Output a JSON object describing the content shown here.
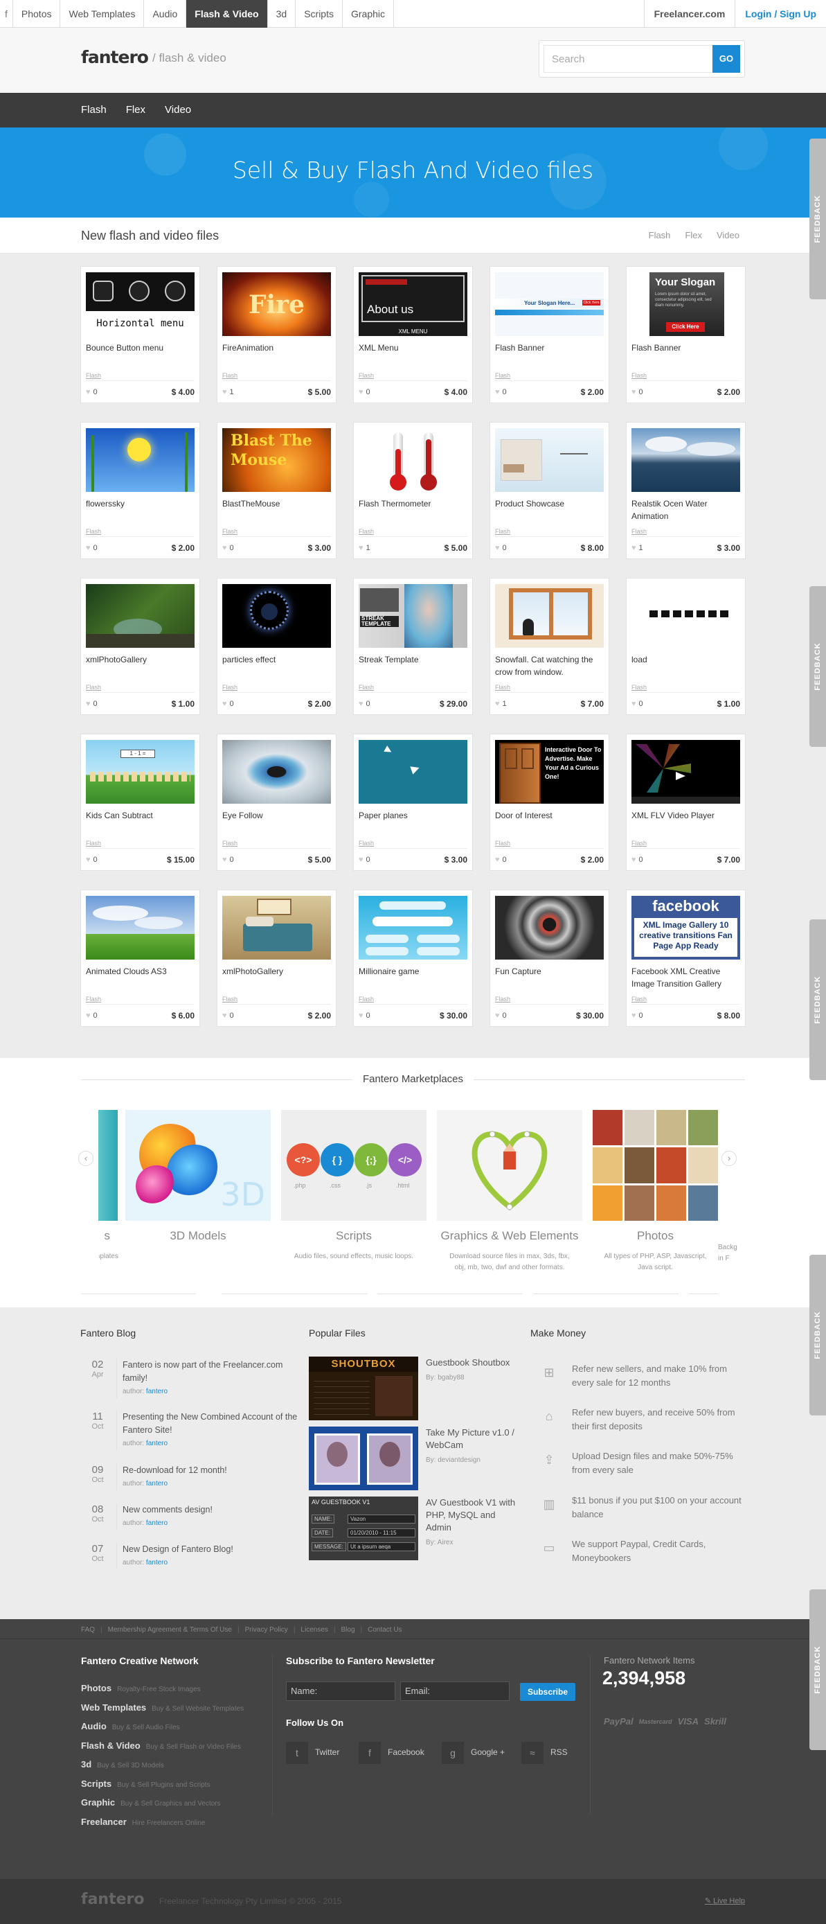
{
  "topbar": {
    "home": "f",
    "categories": [
      "Photos",
      "Web Templates",
      "Audio",
      "Flash & Video",
      "3d",
      "Scripts",
      "Graphic"
    ],
    "freelancer": "Freelancer.com",
    "login": "Login / Sign Up"
  },
  "header": {
    "logo": "fantero",
    "section": "/ flash & video",
    "search_placeholder": "Search",
    "search_button": "GO"
  },
  "subnav": [
    "Flash",
    "Flex",
    "Video"
  ],
  "banner": {
    "title": "Sell & Buy Flash And Video files"
  },
  "files": {
    "title": "New flash and video files",
    "filters": [
      "Flash",
      "Flex",
      "Video"
    ],
    "items": [
      {
        "name": "Bounce Button menu",
        "category": "Flash",
        "likes": "0",
        "price": "$ 4.00"
      },
      {
        "name": "FireAnimation",
        "category": "Flash",
        "likes": "1",
        "price": "$ 5.00"
      },
      {
        "name": "XML Menu",
        "category": "Flash",
        "likes": "0",
        "price": "$ 4.00"
      },
      {
        "name": "Flash Banner",
        "category": "Flash",
        "likes": "0",
        "price": "$ 2.00"
      },
      {
        "name": "Flash Banner",
        "category": "Flash",
        "likes": "0",
        "price": "$ 2.00"
      },
      {
        "name": "flowerssky",
        "category": "Flash",
        "likes": "0",
        "price": "$ 2.00"
      },
      {
        "name": "BlastTheMouse",
        "category": "Flash",
        "likes": "0",
        "price": "$ 3.00"
      },
      {
        "name": "Flash Thermometer",
        "category": "Flash",
        "likes": "1",
        "price": "$ 5.00"
      },
      {
        "name": "Product Showcase",
        "category": "Flash",
        "likes": "0",
        "price": "$ 8.00"
      },
      {
        "name": "Realstik Ocen Water Animation",
        "category": "Flash",
        "likes": "1",
        "price": "$ 3.00"
      },
      {
        "name": "xmlPhotoGallery",
        "category": "Flash",
        "likes": "0",
        "price": "$ 1.00"
      },
      {
        "name": "particles effect",
        "category": "Flash",
        "likes": "0",
        "price": "$ 2.00"
      },
      {
        "name": "Streak Template",
        "category": "Flash",
        "likes": "0",
        "price": "$ 29.00"
      },
      {
        "name": "Snowfall. Cat watching the crow from window.",
        "category": "Flash",
        "likes": "1",
        "price": "$ 7.00"
      },
      {
        "name": "load",
        "category": "Flash",
        "likes": "0",
        "price": "$ 1.00"
      },
      {
        "name": "Kids Can Subtract",
        "category": "Flash",
        "likes": "0",
        "price": "$ 15.00"
      },
      {
        "name": "Eye Follow",
        "category": "Flash",
        "likes": "0",
        "price": "$ 5.00"
      },
      {
        "name": "Paper planes",
        "category": "Flash",
        "likes": "0",
        "price": "$ 3.00"
      },
      {
        "name": "Door of Interest",
        "category": "Flash",
        "likes": "0",
        "price": "$ 2.00"
      },
      {
        "name": "XML FLV Video Player",
        "category": "Flash",
        "likes": "0",
        "price": "$ 7.00"
      },
      {
        "name": "Animated Clouds AS3",
        "category": "Flash",
        "likes": "0",
        "price": "$ 6.00"
      },
      {
        "name": "xmlPhotoGallery",
        "category": "Flash",
        "likes": "0",
        "price": "$ 2.00"
      },
      {
        "name": "Millionaire game",
        "category": "Flash",
        "likes": "0",
        "price": "$ 30.00"
      },
      {
        "name": "Fun Capture",
        "category": "Flash",
        "likes": "0",
        "price": "$ 30.00"
      },
      {
        "name": "Facebook XML Creative Image Transition Gallery",
        "category": "Flash",
        "likes": "0",
        "price": "$ 8.00"
      }
    ],
    "thumb_text": {
      "horizontal_menu": "Horizontal menu",
      "fire": "Fire",
      "about_us": "About us",
      "xml_menu": "XML MENU",
      "your_slogan_here": "Your Slogan Here...",
      "your_slogan": "Your Slogan",
      "slogan_body": "Lorem ipsum dolor sit amet, consectetur adipiscing elit, sed diam nonummy.",
      "click_here": "Click Here",
      "blast": "Blast The Mouse",
      "streak": "STREAK TEMPLATE",
      "interactive_door": "Interactive Door To Advertise. Make Your Ad a Curious One!",
      "facebook": "facebook",
      "fb_sub": "XML Image Gallery 10 creative transitions Fan Page App Ready"
    }
  },
  "marketplaces": {
    "title": "Fantero Marketplaces",
    "items": [
      {
        "name": "s",
        "desc": "best way to sell & buy Design Templates"
      },
      {
        "name": "3D Models",
        "desc": ""
      },
      {
        "name": "Scripts",
        "desc": "Audio files, sound effects, music loops."
      },
      {
        "name": "Graphics & Web Elements",
        "desc": "Download source files in max, 3ds, fbx, obj, mb, two, dwf and other formats."
      },
      {
        "name": "Photos",
        "desc": "All types of PHP, ASP, Javascript, Java script."
      },
      {
        "name": "",
        "desc": "Backgr in F"
      }
    ],
    "script_icons": [
      "<?>",
      "{ }",
      "{;}",
      "</>"
    ],
    "script_labels": [
      ".php",
      ".css",
      ".js",
      ".html"
    ],
    "prev": "‹",
    "next": "›"
  },
  "blog": {
    "title": "Fantero Blog",
    "author_label": "author:",
    "items": [
      {
        "day": "02",
        "month": "Apr",
        "text": "Fantero is now part of the Freelancer.com family!",
        "author": "fantero"
      },
      {
        "day": "11",
        "month": "Oct",
        "text": "Presenting the New Combined Account of the Fantero Site!",
        "author": "fantero"
      },
      {
        "day": "09",
        "month": "Oct",
        "text": "Re-download for 12 month!",
        "author": "fantero"
      },
      {
        "day": "08",
        "month": "Oct",
        "text": "New comments design!",
        "author": "fantero"
      },
      {
        "day": "07",
        "month": "Oct",
        "text": "New Design of Fantero Blog!",
        "author": "fantero"
      }
    ]
  },
  "popular": {
    "title": "Popular Files",
    "items": [
      {
        "name": "Guestbook Shoutbox",
        "by": "By: bgaby88"
      },
      {
        "name": "Take My Picture v1.0 / WebCam",
        "by": "By: deviantdesign"
      },
      {
        "name": "AV Guestbook V1 with PHP, MySQL and Admin",
        "by": "By: Airex"
      }
    ],
    "thumb_text": {
      "shoutbox": "SHOUTBOX",
      "avgb": "AV GUESTBOOK V1",
      "name": "NAME:",
      "name_val": "Vazon",
      "date": "DATE:",
      "date_val": "01/20/2010 - 11:15",
      "message": "MESSAGE:",
      "message_val": "Ut a ipsum aeqa"
    }
  },
  "make_money": {
    "title": "Make Money",
    "items": [
      {
        "icon": "refer-sellers-icon",
        "text": "Refer new sellers, and make 10% from every sale for 12 months"
      },
      {
        "icon": "basket-icon",
        "text": "Refer new buyers, and receive 50% from their first deposits"
      },
      {
        "icon": "upload-icon",
        "text": "Upload Design files and make 50%-75% from every sale"
      },
      {
        "icon": "chart-icon",
        "text": "$11 bonus if you put $100 on your account balance"
      },
      {
        "icon": "wallet-icon",
        "text": "We support Paypal, Credit Cards, Moneybookers"
      }
    ]
  },
  "footer": {
    "links": [
      "FAQ",
      "Membership Agreement & Terms Of Use",
      "Privacy Policy",
      "Licenses",
      "Blog",
      "Contact Us"
    ],
    "network_title": "Fantero Creative Network",
    "network": [
      {
        "name": "Photos",
        "desc": "Royalty-Free Stock Images"
      },
      {
        "name": "Web Templates",
        "desc": "Buy & Sell Website Templates"
      },
      {
        "name": "Audio",
        "desc": "Buy & Sell Audio Files"
      },
      {
        "name": "Flash & Video",
        "desc": "Buy & Sell Flash or Video Files"
      },
      {
        "name": "3d",
        "desc": "Buy & Sell 3D Models"
      },
      {
        "name": "Scripts",
        "desc": "Buy & Sell Plugins and Scripts"
      },
      {
        "name": "Graphic",
        "desc": "Buy & Sell Graphics and Vectors"
      },
      {
        "name": "Freelancer",
        "desc": "Hire Freelancers Online"
      }
    ],
    "newsletter_title": "Subscribe to Fantero Newsletter",
    "name_placeholder": "Name:",
    "email_placeholder": "Email:",
    "subscribe": "Subscribe",
    "follow_title": "Follow Us On",
    "social": [
      {
        "icon": "twitter-icon",
        "glyph": "t",
        "label": "Twitter"
      },
      {
        "icon": "facebook-icon",
        "glyph": "f",
        "label": "Facebook"
      },
      {
        "icon": "google-plus-icon",
        "glyph": "g",
        "label": "Google +"
      },
      {
        "icon": "rss-icon",
        "glyph": "≈",
        "label": "RSS"
      }
    ],
    "items_title": "Fantero Network Items",
    "items_count": "2,394,958",
    "payments": [
      "PayPal",
      "Mastercard",
      "VISA",
      "Skrill"
    ],
    "logo": "fantero",
    "copyright": "Freelancer Technology Pty Limited © 2005 - 2015",
    "help": "Live Help"
  },
  "feedback_label": "FEEDBACK"
}
